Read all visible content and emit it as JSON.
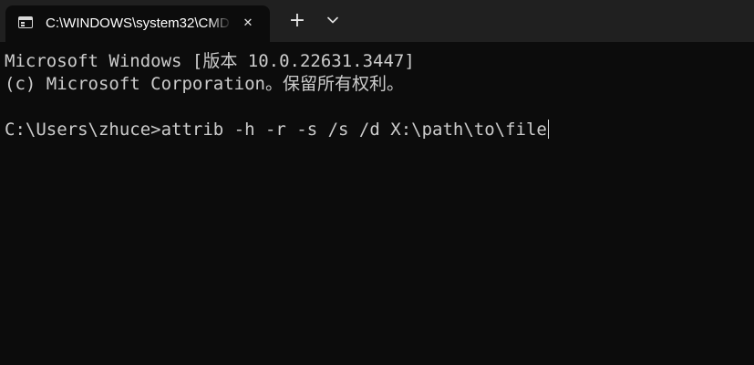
{
  "tab": {
    "title": "C:\\WINDOWS\\system32\\CMD",
    "icon": "terminal-icon",
    "close_label": "✕"
  },
  "tabbar": {
    "new_tab_label": "+",
    "dropdown_icon": "chevron-down-icon"
  },
  "terminal": {
    "line1": "Microsoft Windows [版本 10.0.22631.3447]",
    "line2": "(c) Microsoft Corporation。保留所有权利。",
    "line3": "",
    "prompt": "C:\\Users\\zhuce>",
    "command": "attrib -h -r -s /s /d X:\\path\\to\\file"
  },
  "colors": {
    "background": "#0c0c0c",
    "tabbar": "#202020",
    "text": "#cccccc"
  }
}
